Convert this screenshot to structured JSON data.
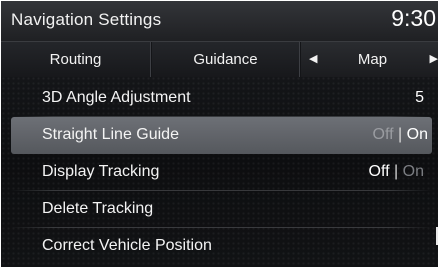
{
  "header": {
    "title": "Navigation Settings",
    "clock": "9:30"
  },
  "tabs": {
    "routing": "Routing",
    "guidance": "Guidance",
    "map": "Map",
    "prev_icon": "left-triangle-icon",
    "next_icon": "right-triangle-icon"
  },
  "settings": [
    {
      "label": "3D Angle Adjustment",
      "value": "5"
    },
    {
      "label": "Straight Line Guide",
      "off": "Off",
      "sep": "|",
      "on": "On",
      "active": "On",
      "selected": true
    },
    {
      "label": "Display Tracking",
      "off": "Off",
      "sep": "|",
      "on": "On",
      "active": "Off"
    },
    {
      "label": "Delete Tracking"
    },
    {
      "label": "Correct Vehicle Position"
    }
  ],
  "colors": {
    "background": "#0d0e10",
    "selected_row": "#60636a",
    "dim_text": "#7b7d82",
    "text": "#f2f2f2"
  }
}
